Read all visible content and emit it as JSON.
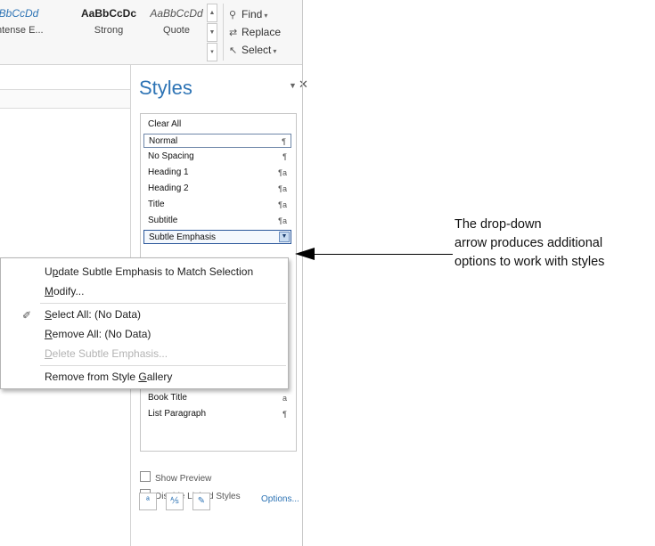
{
  "ribbon": {
    "gallery": [
      {
        "sample": "aBbCcDd",
        "label": "ntense E..."
      },
      {
        "sample": "AaBbCcDc",
        "label": "Strong"
      },
      {
        "sample": "AaBbCcDd",
        "label": "Quote"
      }
    ],
    "editing": {
      "find": "Find",
      "replace": "Replace",
      "select": "Select"
    }
  },
  "styles_pane": {
    "title": "Styles",
    "items": [
      {
        "label": "Clear All",
        "mark": ""
      },
      {
        "label": "Normal",
        "mark": "¶"
      },
      {
        "label": "No Spacing",
        "mark": "¶"
      },
      {
        "label": "Heading 1",
        "mark": "¶a"
      },
      {
        "label": "Heading 2",
        "mark": "¶a"
      },
      {
        "label": "Title",
        "mark": "¶a"
      },
      {
        "label": "Subtitle",
        "mark": "¶a"
      },
      {
        "label": "Subtle Emphasis",
        "mark": ""
      },
      {
        "label": "Book Title",
        "mark": "a"
      },
      {
        "label": "List Paragraph",
        "mark": "¶"
      }
    ],
    "show_preview": "Show Preview",
    "disable_linked": "Disable Linked Styles",
    "options": "Options..."
  },
  "context_menu": {
    "update": [
      "U",
      "p",
      "date Subtle Emphasis to Match Selection"
    ],
    "modify": [
      "",
      "M",
      "odify..."
    ],
    "select_all": [
      "",
      "S",
      "elect All: (No Data)"
    ],
    "remove_all": [
      "",
      "R",
      "emove All: (No Data)"
    ],
    "delete": [
      "",
      "D",
      "elete Subtle Emphasis..."
    ],
    "remove_gallery": [
      "Remove from Style ",
      "G",
      "allery"
    ]
  },
  "callout": {
    "line1": "The drop-down",
    "line2": "arrow produces additional",
    "line3": "options to work with styles"
  },
  "icons": {
    "find": "binoculars-icon",
    "replace": "replace-icon",
    "select": "cursor-arrow-icon",
    "modify": "pencil-icon"
  },
  "colors": {
    "accent": "#2e74b5",
    "selection_border": "#2b579a"
  }
}
